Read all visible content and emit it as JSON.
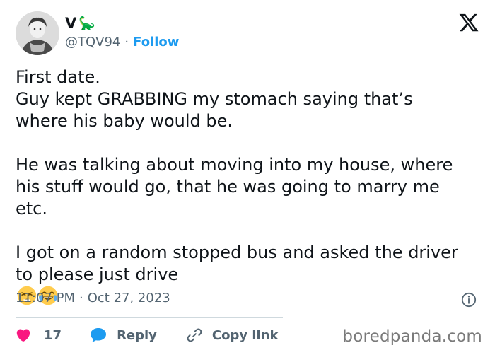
{
  "author": {
    "name": "V",
    "name_emoji": "🦕",
    "handle": "@TQV94",
    "separator": "·",
    "follow_label": "Follow"
  },
  "tweet": {
    "paragraphs": [
      "First date.\nGuy kept GRABBING my stomach saying that’s where his baby would be.",
      "He was talking about moving into my house, where his stuff would go, that he was going to marry me etc.",
      "I got on a random stopped bus and asked the driver to please just drive"
    ],
    "end_emojis": [
      "weary-face",
      "face-with-tears-of-joy"
    ]
  },
  "meta": {
    "time": "11:07 PM",
    "separator": "·",
    "date": "Oct 27, 2023"
  },
  "actions": {
    "likes_count": "17",
    "reply_label": "Reply",
    "copy_link_label": "Copy link"
  },
  "watermark": "boredpanda.com",
  "colors": {
    "accent": "#1d9bf0",
    "like": "#f91880",
    "text": "#0f1419",
    "muted": "#536471"
  }
}
